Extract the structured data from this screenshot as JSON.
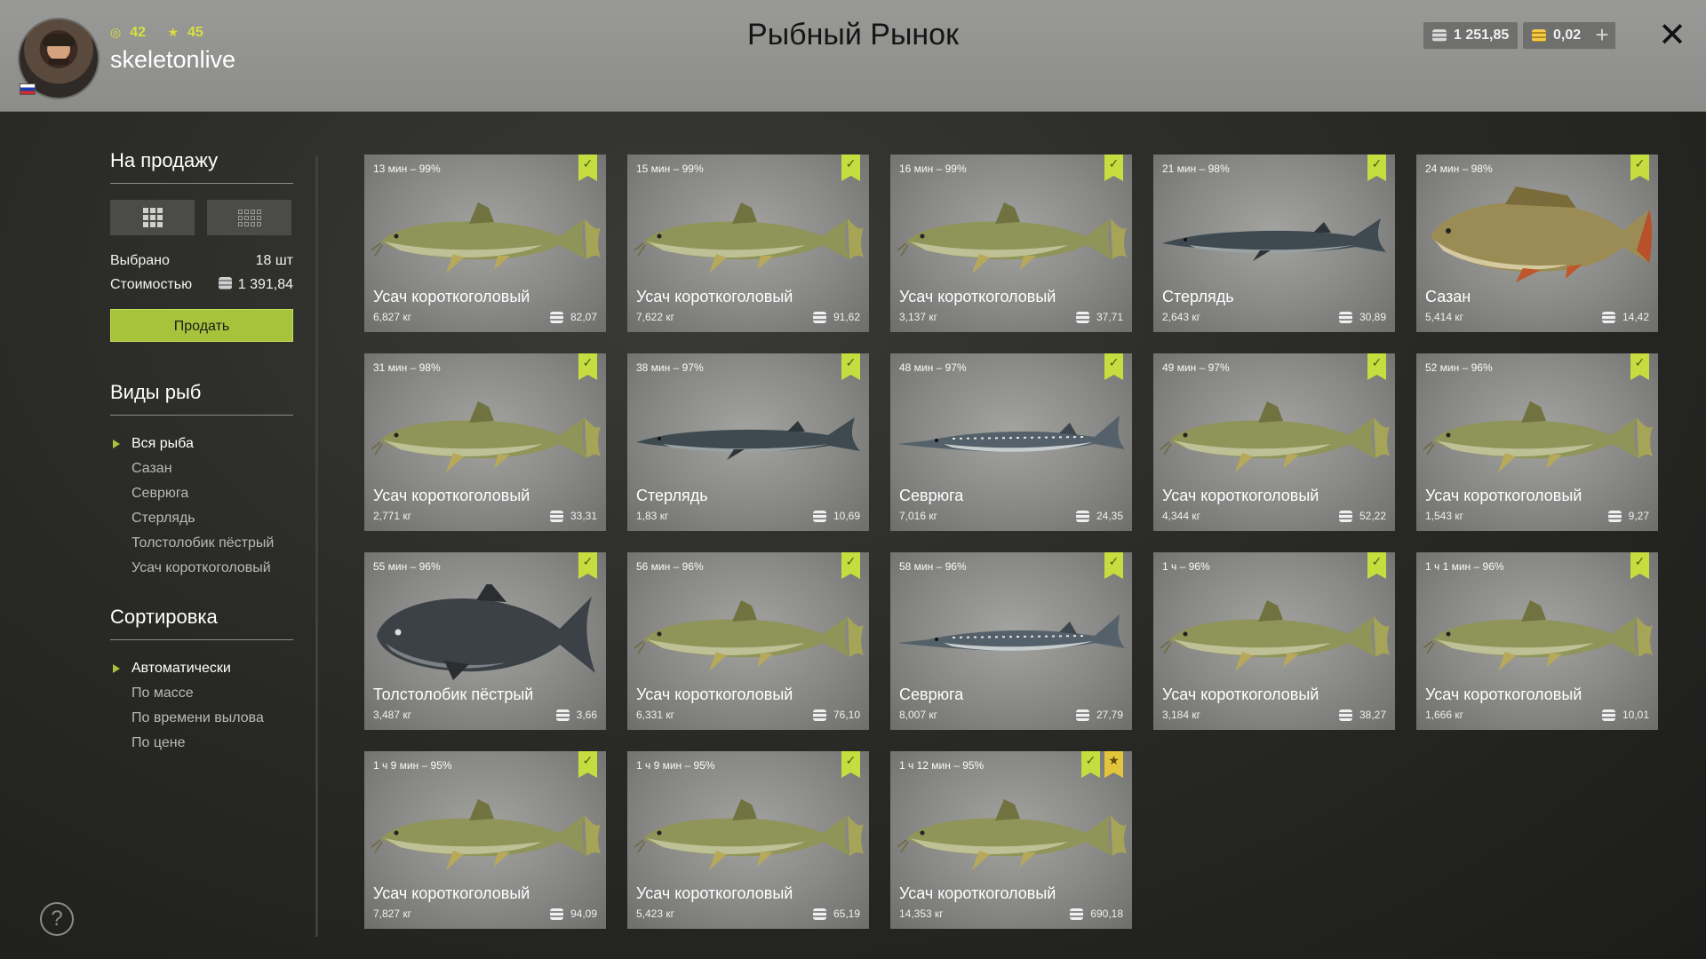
{
  "header": {
    "title": "Рыбный Рынок",
    "username": "skeletonlive",
    "stat_level": "42",
    "stat_stars": "45",
    "silver": "1 251,85",
    "gold": "0,02",
    "plus": "+",
    "close": "✕"
  },
  "sidebar": {
    "for_sale_title": "На продажу",
    "selected_label": "Выбрано",
    "selected_value": "18 шт",
    "cost_label": "Стоимостью",
    "cost_value": "1 391,84",
    "sell_button": "Продать",
    "species_title": "Виды рыб",
    "species": [
      "Вся рыба",
      "Сазан",
      "Севрюга",
      "Стерлядь",
      "Толстолобик пёстрый",
      "Усач короткоголовый"
    ],
    "species_active": 0,
    "sort_title": "Сортировка",
    "sort": [
      "Автоматически",
      "По массе",
      "По времени вылова",
      "По цене"
    ],
    "sort_active": 0
  },
  "help": "?",
  "cards": [
    {
      "time": "13 мин – 99%",
      "name": "Усач короткоголовый",
      "weight": "6,827 кг",
      "price": "82,07",
      "type": "barbel",
      "star": false
    },
    {
      "time": "15 мин – 99%",
      "name": "Усач короткоголовый",
      "weight": "7,622 кг",
      "price": "91,62",
      "type": "barbel",
      "star": false
    },
    {
      "time": "16 мин – 99%",
      "name": "Усач короткоголовый",
      "weight": "3,137 кг",
      "price": "37,71",
      "type": "barbel",
      "star": false
    },
    {
      "time": "21 мин – 98%",
      "name": "Стерлядь",
      "weight": "2,643 кг",
      "price": "30,89",
      "type": "sterlet",
      "star": false
    },
    {
      "time": "24 мин – 98%",
      "name": "Сазан",
      "weight": "5,414 кг",
      "price": "14,42",
      "type": "carp",
      "star": false
    },
    {
      "time": "31 мин – 98%",
      "name": "Усач короткоголовый",
      "weight": "2,771 кг",
      "price": "33,31",
      "type": "barbel",
      "star": false
    },
    {
      "time": "38 мин – 97%",
      "name": "Стерлядь",
      "weight": "1,83 кг",
      "price": "10,69",
      "type": "sterlet",
      "star": false
    },
    {
      "time": "48 мин – 97%",
      "name": "Севрюга",
      "weight": "7,016 кг",
      "price": "24,35",
      "type": "sevruga",
      "star": false
    },
    {
      "time": "49 мин – 97%",
      "name": "Усач короткоголовый",
      "weight": "4,344 кг",
      "price": "52,22",
      "type": "barbel",
      "star": false
    },
    {
      "time": "52 мин – 96%",
      "name": "Усач короткоголовый",
      "weight": "1,543 кг",
      "price": "9,27",
      "type": "barbel",
      "star": false
    },
    {
      "time": "55 мин – 96%",
      "name": "Толстолобик пёстрый",
      "weight": "3,487 кг",
      "price": "3,66",
      "type": "bighead",
      "star": false
    },
    {
      "time": "56 мин – 96%",
      "name": "Усач короткоголовый",
      "weight": "6,331 кг",
      "price": "76,10",
      "type": "barbel",
      "star": false
    },
    {
      "time": "58 мин – 96%",
      "name": "Севрюга",
      "weight": "8,007 кг",
      "price": "27,79",
      "type": "sevruga",
      "star": false
    },
    {
      "time": "1 ч – 96%",
      "name": "Усач короткоголовый",
      "weight": "3,184 кг",
      "price": "38,27",
      "type": "barbel",
      "star": false
    },
    {
      "time": "1 ч 1 мин – 96%",
      "name": "Усач короткоголовый",
      "weight": "1,666 кг",
      "price": "10,01",
      "type": "barbel",
      "star": false
    },
    {
      "time": "1 ч 9 мин – 95%",
      "name": "Усач короткоголовый",
      "weight": "7,827 кг",
      "price": "94,09",
      "type": "barbel",
      "star": false
    },
    {
      "time": "1 ч 9 мин – 95%",
      "name": "Усач короткоголовый",
      "weight": "5,423 кг",
      "price": "65,19",
      "type": "barbel",
      "star": false
    },
    {
      "time": "1 ч 12 мин – 95%",
      "name": "Усач короткоголовый",
      "weight": "14,353 кг",
      "price": "690,18",
      "type": "barbel",
      "star": true
    }
  ],
  "colors": {
    "accent": "#a7c23b",
    "ribbon": "#c5dd3e",
    "star_ribbon": "#e3c53c"
  }
}
